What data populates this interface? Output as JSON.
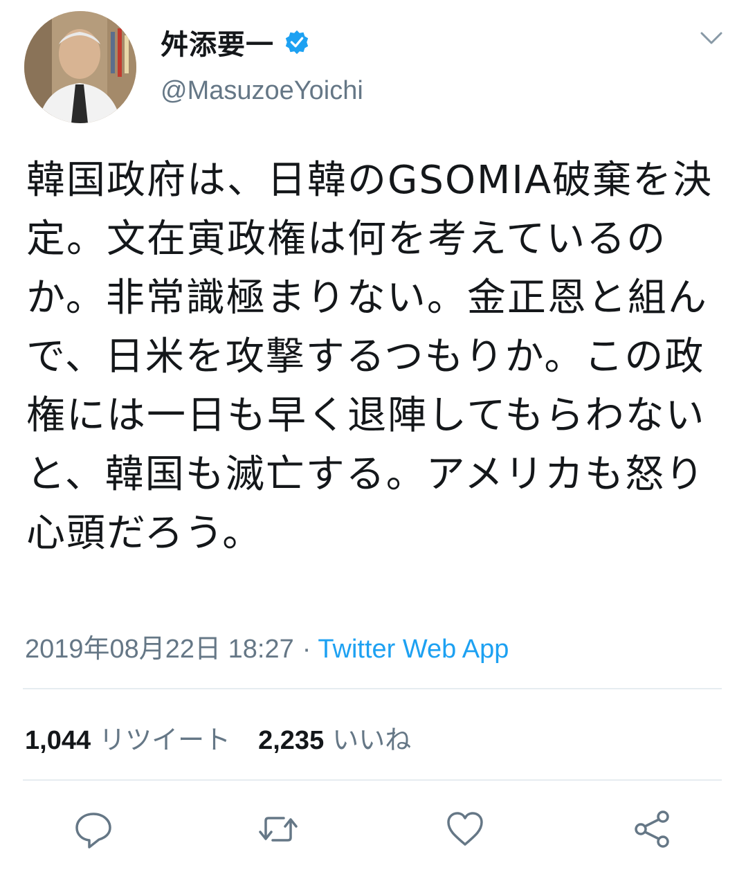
{
  "tweet": {
    "display_name": "舛添要一",
    "handle": "@MasuzoeYoichi",
    "text": "韓国政府は、日韓のGSOMIA破棄を決定。文在寅政権は何を考えているのか。非常識極まりない。金正恩と組んで、日米を攻撃するつもりか。この政権には一日も早く退陣してもらわないと、韓国も滅亡する。アメリカも怒り心頭だろう。",
    "timestamp": "2019年08月22日 18:27",
    "separator": "·",
    "source": "Twitter Web App",
    "retweets_count": "1,044",
    "retweets_label": "リツイート",
    "likes_count": "2,235",
    "likes_label": "いいね"
  },
  "colors": {
    "accent": "#1da1f2",
    "secondary_text": "#657786",
    "divider": "#e6ecf0"
  },
  "icons": [
    "verified-badge-icon",
    "chevron-down-icon",
    "reply-icon",
    "retweet-icon",
    "like-icon",
    "share-icon"
  ]
}
